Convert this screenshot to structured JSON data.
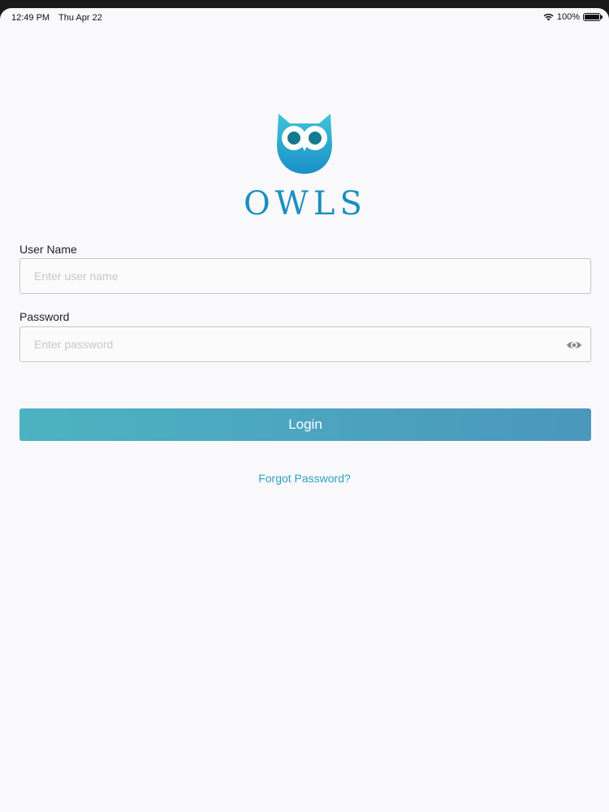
{
  "status_bar": {
    "time": "12:49 PM",
    "date": "Thu Apr 22",
    "battery": "100%"
  },
  "logo": {
    "word": "OWLS",
    "icon": "owl-icon"
  },
  "form": {
    "username_label": "User Name",
    "username_placeholder": "Enter user name",
    "password_label": "Password",
    "password_placeholder": "Enter password",
    "password_toggle_icon": "eye-icon"
  },
  "actions": {
    "login_label": "Login",
    "forgot_label": "Forgot Password?"
  },
  "colors": {
    "brand": "#1a8fbf",
    "button_start": "#4cb3c1",
    "button_end": "#4b97bd",
    "link": "#2f9fc6",
    "background": "#f9f9fb"
  }
}
